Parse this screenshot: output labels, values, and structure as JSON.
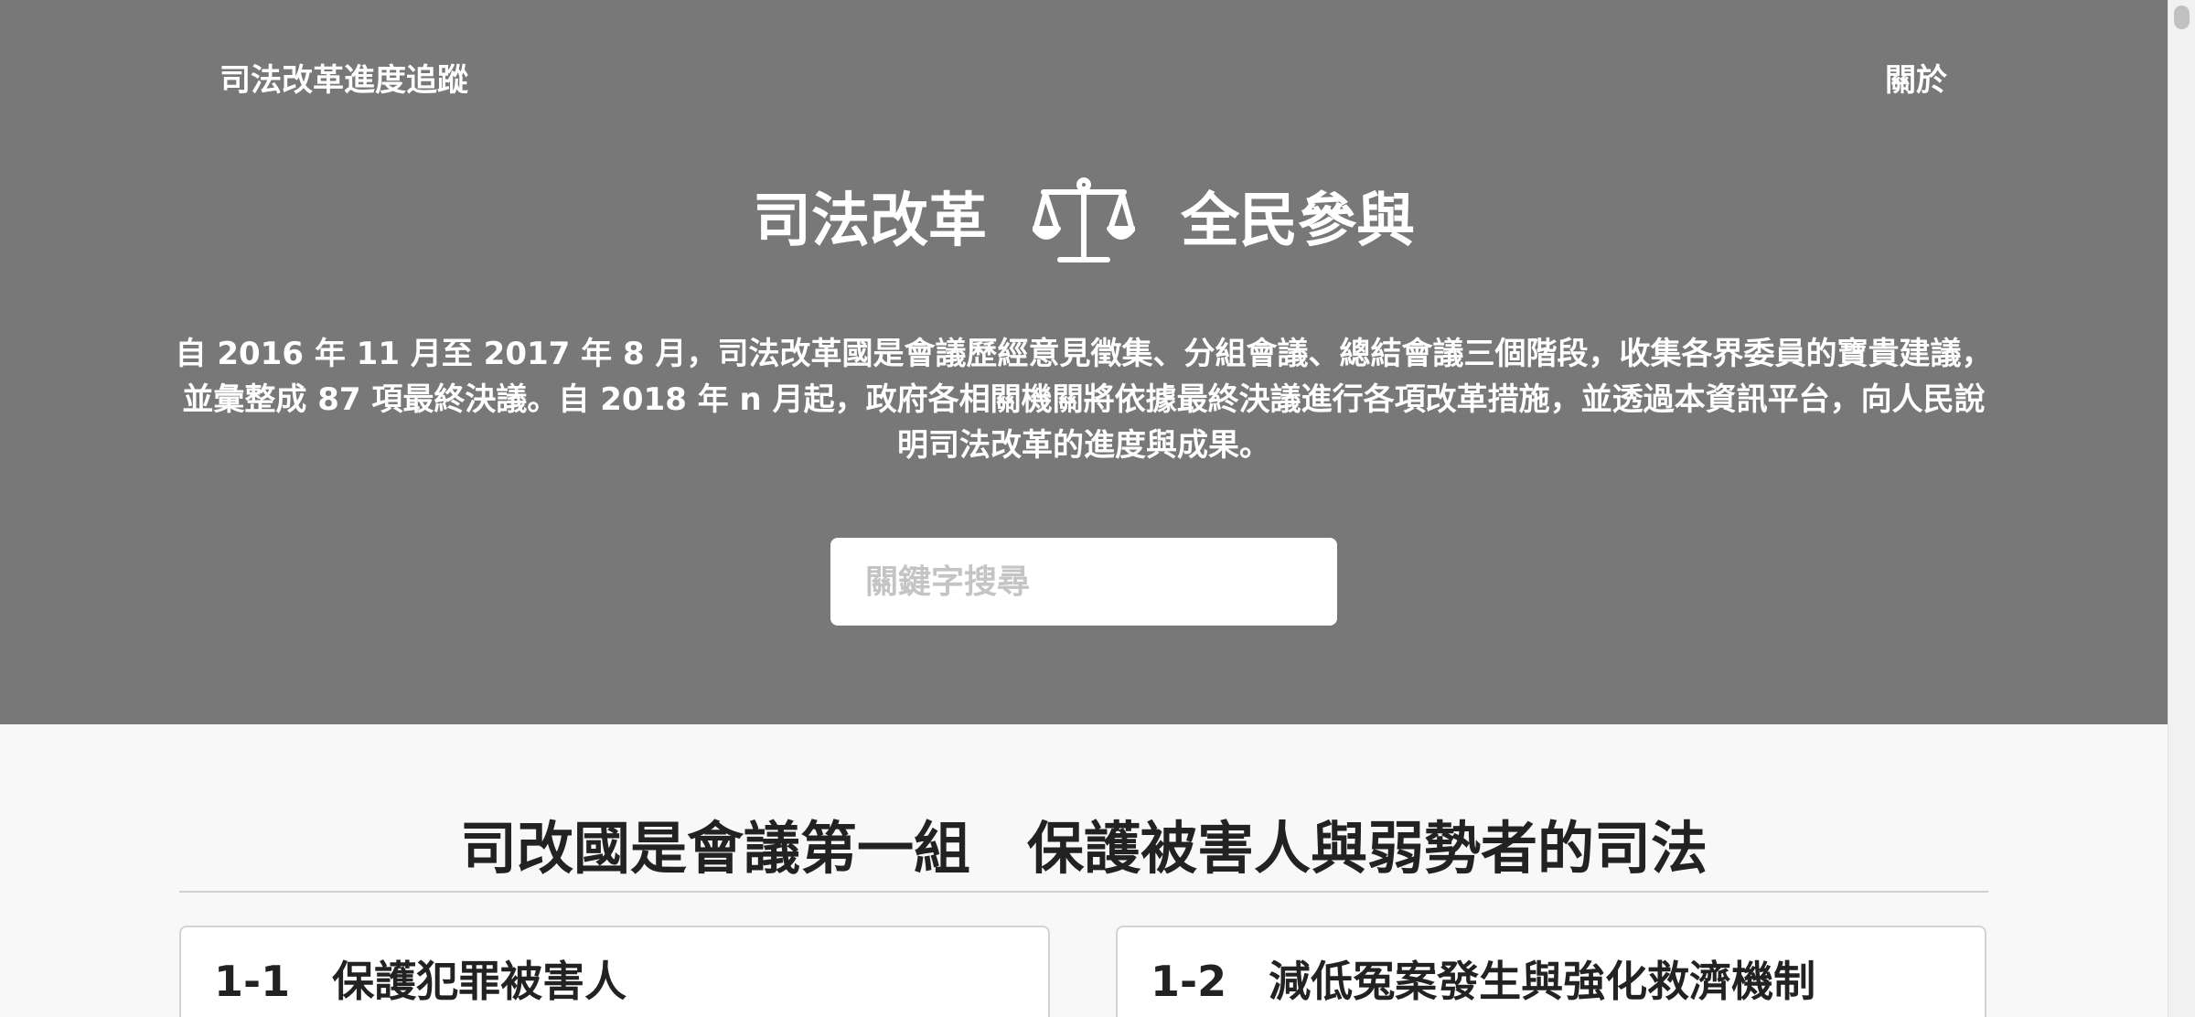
{
  "nav": {
    "brand": "司法改革進度追蹤",
    "about": "關於"
  },
  "hero": {
    "title_left": "司法改革",
    "title_right": "全民參與",
    "title_icon": "scales-of-justice-icon",
    "description": "自 2016 年 11 月至 2017 年 8 月，司法改革國是會議歷經意見徵集、分組會議、總結會議三個階段，收集各界委員的寶貴建議，並彙整成 87 項最終決議。自 2018 年 n 月起，政府各相關機關將依據最終決議進行各項改革措施，並透過本資訊平台，向人民說明司法改革的進度與成果。",
    "background_color": "#787878"
  },
  "search": {
    "placeholder": "關鍵字搜尋",
    "value": "",
    "button_icon": "search-icon"
  },
  "section": {
    "title": "司改國是會議第一組　保護被害人與弱勢者的司法"
  },
  "cards": [
    {
      "title": "1-1　保護犯罪被害人"
    },
    {
      "title": "1-2　減低冤案發生與強化救濟機制"
    }
  ]
}
